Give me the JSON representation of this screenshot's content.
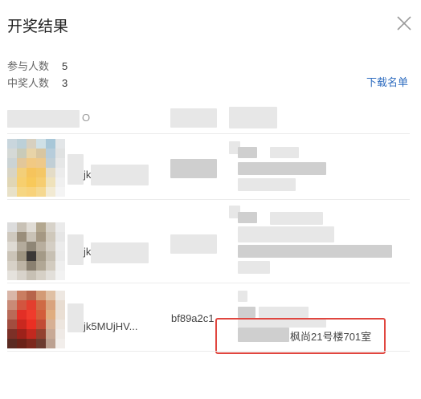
{
  "dialog": {
    "title": "开奖结果",
    "participants_label": "参与人数",
    "participants_value": "5",
    "winners_label": "中奖人数",
    "winners_value": "3",
    "download_label": "下载名单"
  },
  "table": {
    "header_fragment": "O",
    "rows": [
      {
        "name_fragment": "jk",
        "id_fragment": "",
        "address_fragment": ""
      },
      {
        "name_fragment": "jk",
        "id_fragment": "",
        "address_fragment": ""
      },
      {
        "name_fragment": "jk5MUjHV...",
        "id_fragment": "bf89a2c1",
        "address_fragment": "枫尚21号楼701室"
      }
    ]
  },
  "colors": {
    "link": "#2f6dc0",
    "highlight_border": "#e0463f",
    "divider": "#ececec"
  },
  "icons": {
    "close": "close-icon"
  }
}
